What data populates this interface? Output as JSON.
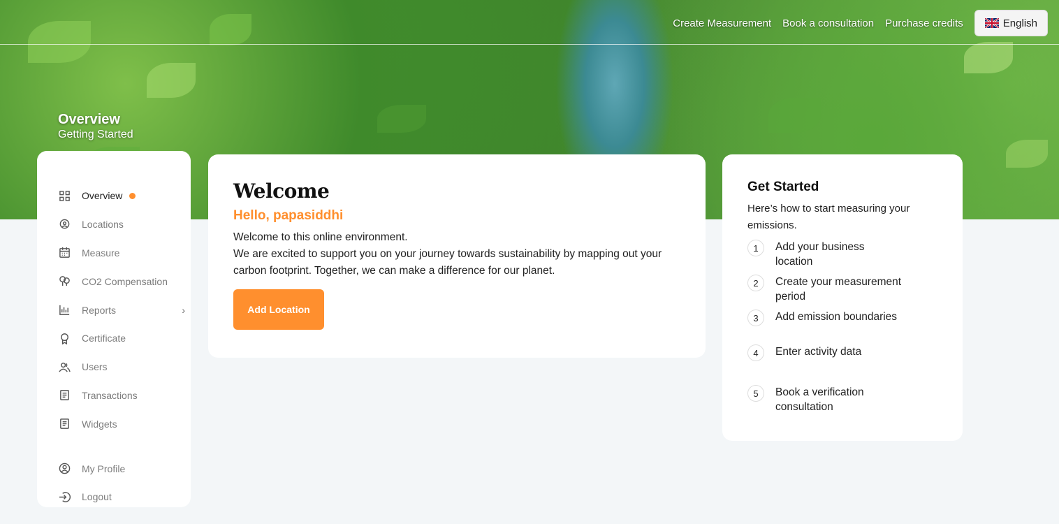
{
  "topnav": {
    "links": [
      "Create Measurement",
      "Book a consultation",
      "Purchase credits"
    ],
    "language": "English"
  },
  "page": {
    "title": "Overview",
    "subtitle": "Getting Started"
  },
  "sidebar": {
    "items": [
      {
        "label": "Overview",
        "icon": "grid-icon"
      },
      {
        "label": "Locations",
        "icon": "location-pin-icon"
      },
      {
        "label": "Measure",
        "icon": "calendar-icon"
      },
      {
        "label": "CO2 Compensation",
        "icon": "trees-icon"
      },
      {
        "label": "Reports",
        "icon": "bar-chart-icon"
      },
      {
        "label": "Certificate",
        "icon": "award-icon"
      },
      {
        "label": "Users",
        "icon": "users-icon"
      },
      {
        "label": "Transactions",
        "icon": "receipt-icon"
      },
      {
        "label": "Widgets",
        "icon": "receipt-icon"
      }
    ],
    "bottom_items": [
      {
        "label": "My Profile",
        "icon": "user-circle-icon"
      },
      {
        "label": "Logout",
        "icon": "logout-icon"
      }
    ],
    "accent": "#ff8f2e"
  },
  "welcome": {
    "title": "Welcome",
    "greeting": "Hello, papasiddhi",
    "line1": "Welcome to this online environment.",
    "line2": "We are excited to support you on your journey towards sustainability by mapping out your carbon footprint. Together, we can make a difference for our planet.",
    "button": "Add Location"
  },
  "get_started": {
    "title": "Get Started",
    "intro": "Here’s how to start measuring your emissions.",
    "steps": [
      {
        "num": "1",
        "text": "Add your business location"
      },
      {
        "num": "2",
        "text": "Create your measurement period"
      },
      {
        "num": "3",
        "text": "Add emission boundaries"
      },
      {
        "num": "4",
        "text": "Enter activity data"
      },
      {
        "num": "5",
        "text": "Book a verification consultation"
      }
    ]
  }
}
